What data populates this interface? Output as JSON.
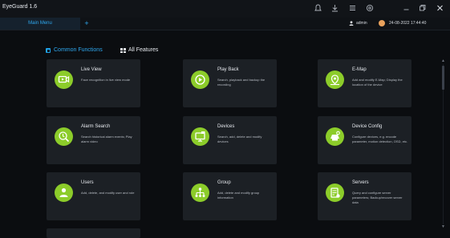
{
  "app": {
    "title": "EyeGuard 1.6"
  },
  "window_controls": [
    {
      "name": "alarm-bell-icon",
      "glyph": "♫"
    },
    {
      "name": "download-icon",
      "glyph": "⤓"
    },
    {
      "name": "menu-icon",
      "glyph": "≡"
    },
    {
      "name": "settings-icon",
      "glyph": "⚙"
    },
    {
      "name": "minimize-icon",
      "glyph": "—"
    },
    {
      "name": "restore-icon",
      "glyph": "❐"
    },
    {
      "name": "close-icon",
      "glyph": "✕"
    }
  ],
  "tabs": {
    "main_label": "Main Menu",
    "add_glyph": "+"
  },
  "user": {
    "name": "admin",
    "datetime": "24-08-2022 17:44:40"
  },
  "nav": {
    "common_label": "Common Functions",
    "all_label": "All Features"
  },
  "colors": {
    "accent": "#2fa9f0",
    "icon_green": "#8ccc2a",
    "card_bg": "#1c2025"
  },
  "cards": [
    {
      "title": "Live View",
      "desc": "Face recognition in live view mode",
      "icon": "live-view-icon"
    },
    {
      "title": "Play Back",
      "desc": "Search, playback and backup the recording",
      "icon": "playback-icon"
    },
    {
      "title": "E-Map",
      "desc": "Add and modify E-Map; Display the location of the device",
      "icon": "emap-icon"
    },
    {
      "title": "Alarm Search",
      "desc": "Search historical alarm events; Play alarm video",
      "icon": "alarm-search-icon"
    },
    {
      "title": "Devices",
      "desc": "Search, add, delete and modify devices",
      "icon": "devices-icon"
    },
    {
      "title": "Device Config",
      "desc": "Configure devices, e.g. encode parameter, motion detection, OSD, etc.",
      "icon": "device-config-icon"
    },
    {
      "title": "Users",
      "desc": "Add, delete, and modify user and role",
      "icon": "users-icon"
    },
    {
      "title": "Group",
      "desc": "Add, delete and modify group information",
      "icon": "group-icon"
    },
    {
      "title": "Servers",
      "desc": "Query and configure server parameters; Backup/recover server data",
      "icon": "servers-icon"
    }
  ],
  "scrollbar": {
    "up_glyph": "▲",
    "down_glyph": "▼"
  }
}
